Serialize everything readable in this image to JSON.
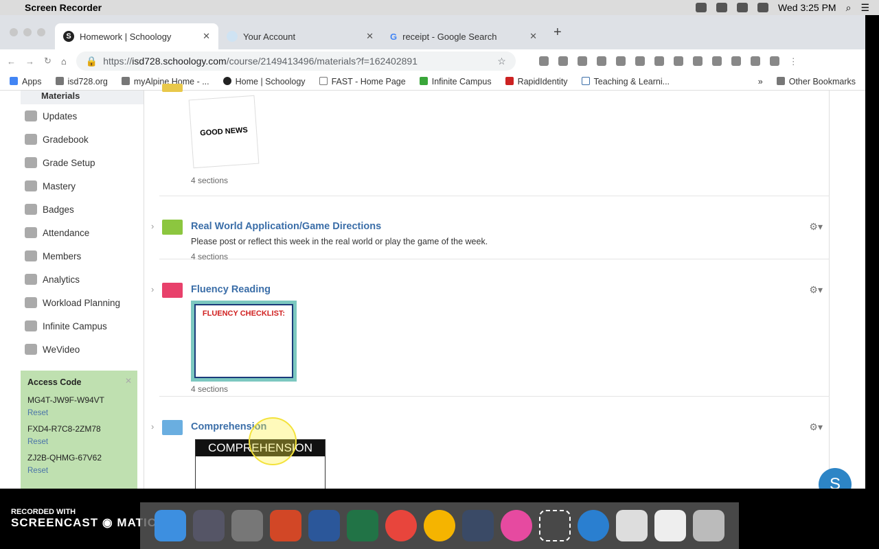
{
  "menubar": {
    "app": "Screen Recorder",
    "clock": "Wed 3:25 PM"
  },
  "tabs": [
    {
      "label": "Homework | Schoology",
      "active": true
    },
    {
      "label": "Your Account"
    },
    {
      "label": "receipt - Google Search"
    }
  ],
  "address": {
    "scheme": "https://",
    "host": "isd728.schoology.com",
    "path": "/course/2149413496/materials?f=162402891"
  },
  "bookmarks": [
    "Apps",
    "isd728.org",
    "myAlpine Home - ...",
    "Home | Schoology",
    "FAST - Home Page",
    "Infinite Campus",
    "RapidIdentity",
    "Teaching & Learni..."
  ],
  "bookmarks_more": "»",
  "other_bookmarks": "Other Bookmarks",
  "sidebar": {
    "current": "Materials",
    "items": [
      "Updates",
      "Gradebook",
      "Grade Setup",
      "Mastery",
      "Badges",
      "Attendance",
      "Members",
      "Analytics",
      "Workload Planning",
      "Infinite Campus",
      "WeVideo"
    ]
  },
  "access_code": {
    "title": "Access Code",
    "codes": [
      "MG4T-JW9F-W94VT",
      "FXD4-R7C8-2ZM78",
      "ZJ2B-QHMG-67V62"
    ],
    "reset": "Reset"
  },
  "materials": [
    {
      "title": "",
      "sections": "4 sections",
      "color": "#e8c84a",
      "thumb": "GOOD NEWS"
    },
    {
      "title": "Real World Application/Game Directions",
      "description": "Please post or reflect this week in the real world or play the game of the week.",
      "sections": "4 sections",
      "color": "#8cc63f"
    },
    {
      "title": "Fluency Reading",
      "sections": "4 sections",
      "color": "#e8416b",
      "thumb": "FLUENCY CHECKLIST:"
    },
    {
      "title": "Comprehension",
      "color": "#6aaee0",
      "thumb": "COMPREHENSION"
    }
  ],
  "chat_button": "S",
  "screencast": {
    "top": "RECORDED WITH",
    "brand": "SCREENCAST ◉ MATIC"
  }
}
